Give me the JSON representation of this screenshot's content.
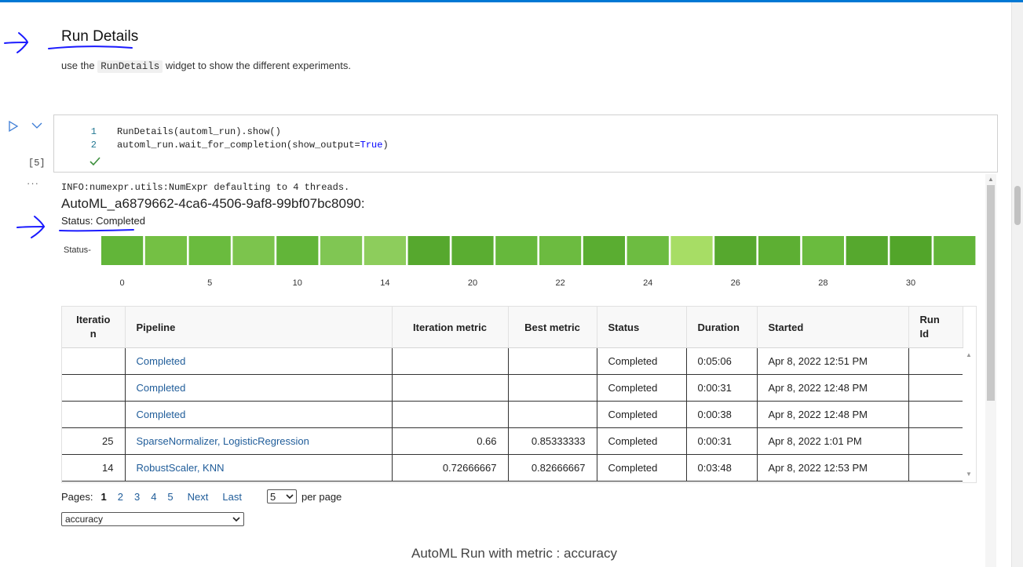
{
  "markdown": {
    "title": "Run Details",
    "desc_before": "use the",
    "desc_code": "RunDetails",
    "desc_after": "widget to show the different experiments."
  },
  "cell": {
    "execution_count": "[5]",
    "output_toggle": "···",
    "lines": [
      {
        "num": "1",
        "text": "RunDetails(automl_run).show()"
      },
      {
        "num": "2",
        "text_before": "automl_run.wait_for_completion(show_output=",
        "keyword": "True",
        "text_after": ")"
      }
    ]
  },
  "output": {
    "info": "INFO:numexpr.utils:NumExpr defaulting to 4 threads.",
    "run_name": "AutoML_a6879662-4ca6-4506-9af8-99bf07bc8090:",
    "status": "Status: Completed"
  },
  "chart_data": {
    "type": "heatmap",
    "ylabel": "Status",
    "x_tick_labels": [
      "0",
      "5",
      "10",
      "14",
      "20",
      "22",
      "24",
      "26",
      "28",
      "30"
    ],
    "cells": 20,
    "cell_colors": [
      "#62b539",
      "#74c044",
      "#6abb3e",
      "#7cc44d",
      "#62b539",
      "#80c653",
      "#8dcd5c",
      "#56a82e",
      "#5aad31",
      "#66b83c",
      "#6cbb40",
      "#5aad31",
      "#6dbc41",
      "#a7dd65",
      "#56a82e",
      "#5daf33",
      "#6abb3e",
      "#56a82e",
      "#52a52a",
      "#62b539"
    ]
  },
  "table": {
    "headers": [
      "Iteration",
      "Pipeline",
      "Iteration metric",
      "Best metric",
      "Status",
      "Duration",
      "Started",
      "Run Id"
    ],
    "header_display": {
      "iteration": [
        "Iteratio",
        "n"
      ],
      "run_id": [
        "Run",
        "Id"
      ]
    },
    "rows": [
      {
        "iteration": "",
        "pipeline": "Completed",
        "iter_metric": "",
        "best_metric": "",
        "status": "Completed",
        "duration": "0:05:06",
        "started": "Apr 8, 2022 12:51 PM",
        "run_id": ""
      },
      {
        "iteration": "",
        "pipeline": "Completed",
        "iter_metric": "",
        "best_metric": "",
        "status": "Completed",
        "duration": "0:00:31",
        "started": "Apr 8, 2022 12:48 PM",
        "run_id": ""
      },
      {
        "iteration": "",
        "pipeline": "Completed",
        "iter_metric": "",
        "best_metric": "",
        "status": "Completed",
        "duration": "0:00:38",
        "started": "Apr 8, 2022 12:48 PM",
        "run_id": ""
      },
      {
        "iteration": "25",
        "pipeline": "SparseNormalizer, LogisticRegression",
        "iter_metric": "0.66",
        "best_metric": "0.85333333",
        "status": "Completed",
        "duration": "0:00:31",
        "started": "Apr 8, 2022 1:01 PM",
        "run_id": ""
      },
      {
        "iteration": "14",
        "pipeline": "RobustScaler, KNN",
        "iter_metric": "0.72666667",
        "best_metric": "0.82666667",
        "status": "Completed",
        "duration": "0:03:48",
        "started": "Apr 8, 2022 12:53 PM",
        "run_id": ""
      }
    ]
  },
  "pager": {
    "label": "Pages:",
    "pages": [
      "1",
      "2",
      "3",
      "4",
      "5"
    ],
    "current": "1",
    "next": "Next",
    "last": "Last",
    "per_page_value": "5",
    "per_page_label": "per page"
  },
  "metric_select": {
    "value": "accuracy"
  },
  "metric_chart": {
    "title": "AutoML Run with metric : accuracy"
  },
  "colors": {
    "accent": "#0078d4",
    "annotation": "#1a1aff",
    "link": "#1f5c99",
    "line_number": "#237893",
    "keyword": "#0000ff"
  }
}
